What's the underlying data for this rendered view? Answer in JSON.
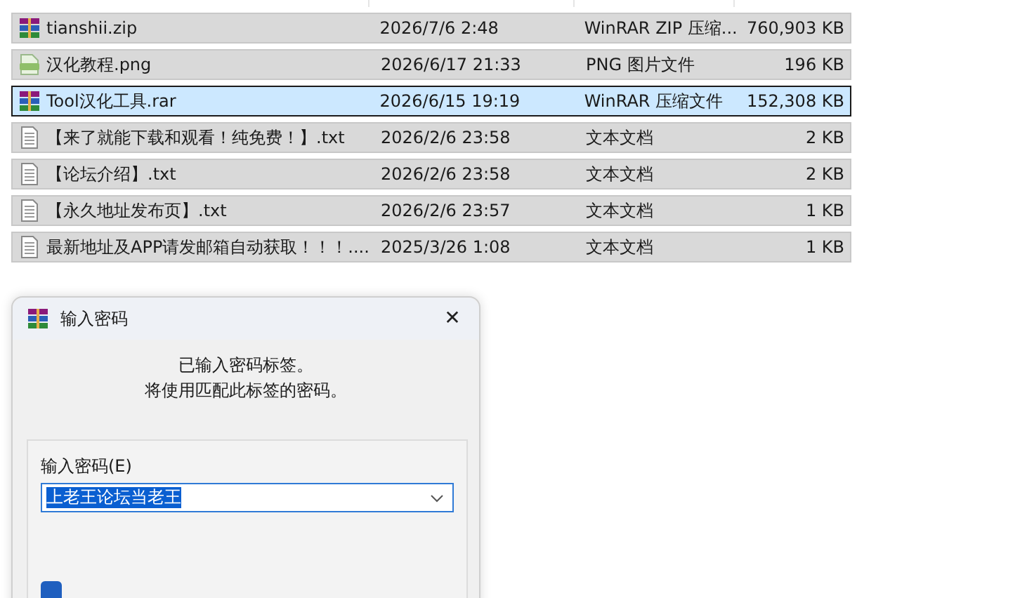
{
  "files": [
    {
      "kind": "archive",
      "name": "tianshii.zip",
      "date": "2026/7/6 2:48",
      "type": "WinRAR ZIP 压缩...",
      "size": "760,903 KB",
      "selected": true,
      "focused": false
    },
    {
      "kind": "image",
      "name": "汉化教程.png",
      "date": "2026/6/17 21:33",
      "type": "PNG 图片文件",
      "size": "196 KB",
      "selected": true,
      "focused": false
    },
    {
      "kind": "archive",
      "name": "Tool汉化工具.rar",
      "date": "2026/6/15 19:19",
      "type": "WinRAR 压缩文件",
      "size": "152,308 KB",
      "selected": true,
      "focused": true
    },
    {
      "kind": "text",
      "name": "【来了就能下载和观看！纯免费！】.txt",
      "date": "2026/2/6 23:58",
      "type": "文本文档",
      "size": "2 KB",
      "selected": true,
      "focused": false
    },
    {
      "kind": "text",
      "name": "【论坛介绍】.txt",
      "date": "2026/2/6 23:58",
      "type": "文本文档",
      "size": "2 KB",
      "selected": true,
      "focused": false
    },
    {
      "kind": "text",
      "name": "【永久地址发布页】.txt",
      "date": "2026/2/6 23:57",
      "type": "文本文档",
      "size": "1 KB",
      "selected": true,
      "focused": false
    },
    {
      "kind": "text",
      "name": "最新地址及APP请发邮箱自动获取！！！....",
      "date": "2025/3/26 1:08",
      "type": "文本文档",
      "size": "1 KB",
      "selected": true,
      "focused": false
    }
  ],
  "dialog": {
    "title": "输入密码",
    "close": "✕",
    "message": [
      "已输入密码标签。",
      "将使用匹配此标签的密码。"
    ],
    "field_label": "输入密码(E)",
    "password": "上老王论坛当老王",
    "checkbox": {
      "checked": true
    }
  }
}
